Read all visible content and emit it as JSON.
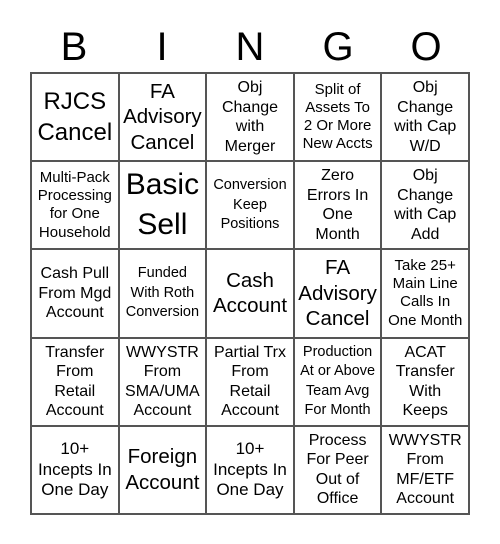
{
  "header": [
    "B",
    "I",
    "N",
    "G",
    "O"
  ],
  "cells": [
    "RJCS\nCancel",
    "FA\nAdvisory\nCancel",
    "Obj\nChange\nwith\nMerger",
    "Split of\nAssets To\n2 Or More\nNew Accts",
    "Obj\nChange\nwith Cap\nW/D",
    "Multi-Pack\nProcessing\nfor One\nHousehold",
    "Basic\nSell",
    "Conversion\nKeep\nPositions",
    "Zero\nErrors In\nOne\nMonth",
    "Obj\nChange\nwith Cap\nAdd",
    "Cash Pull\nFrom Mgd\nAccount",
    "Funded\nWith Roth\nConversion",
    "Cash\nAccount",
    "FA\nAdvisory\nCancel",
    "Take 25+\nMain Line\nCalls In\nOne Month",
    "Transfer\nFrom\nRetail\nAccount",
    "WWYSTR\nFrom\nSMA/UMA\nAccount",
    "Partial Trx\nFrom\nRetail\nAccount",
    "Production\nAt or Above\nTeam Avg\nFor Month",
    "ACAT\nTransfer\nWith\nKeeps",
    "10+\nIncepts In\nOne Day",
    "Foreign\nAccount",
    "10+\nIncepts In\nOne Day",
    "Process\nFor Peer\nOut of\nOffice",
    "WWYSTR\nFrom\nMF/ETF\nAccount"
  ]
}
